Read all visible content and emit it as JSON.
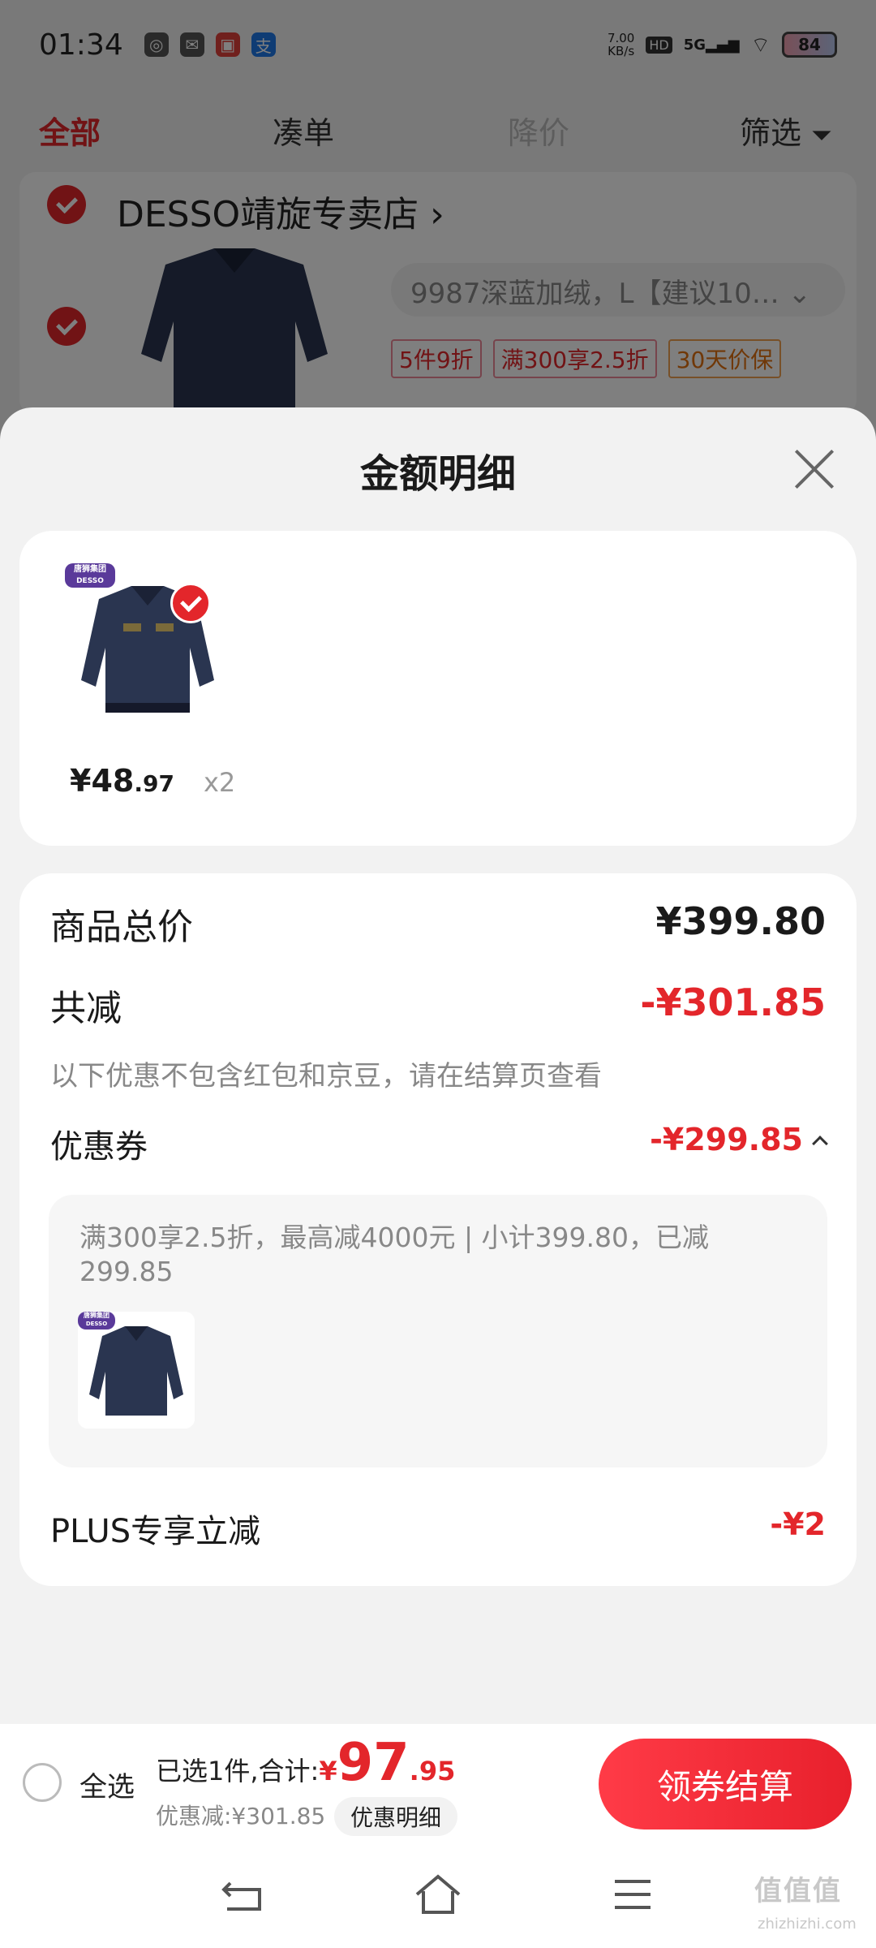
{
  "status_bar": {
    "time": "01:34",
    "net_speed_value": "7.00",
    "net_speed_unit": "KB/s",
    "hd": "HD",
    "signal": "5G",
    "battery": "84"
  },
  "tabs": [
    {
      "label": "全部",
      "state": "active"
    },
    {
      "label": "凑单",
      "state": "normal"
    },
    {
      "label": "降价",
      "state": "disabled"
    },
    {
      "label": "筛选",
      "state": "normal"
    }
  ],
  "cart_item": {
    "shop_name": "DESSO靖旋专卖店",
    "variant": "9987深蓝加绒，L【建议10…",
    "promo_tags": [
      "5件9折",
      "满300享2.5折",
      "30天价保"
    ]
  },
  "sheet": {
    "title": "金额明细",
    "product": {
      "brand_badge_line1": "唐狮集团",
      "brand_badge_line2": "DESSO",
      "price_int": "¥48",
      "price_dec": ".97",
      "qty": "x2"
    },
    "summary": {
      "total_label": "商品总价",
      "total_value": "¥399.80",
      "reduce_label": "共减",
      "reduce_value": "-¥301.85",
      "note": "以下优惠不包含红包和京豆，请在结算页查看",
      "coupon_label": "优惠券",
      "coupon_value": "-¥299.85",
      "coupon_desc": "满300享2.5折，最高减4000元 | 小计399.80，已减299.85",
      "plus_label": "PLUS专享立减",
      "plus_value": "-¥2"
    }
  },
  "checkout": {
    "select_all": "全选",
    "sum_label": "已选1件,合计:",
    "sum_yen": "¥",
    "sum_int": "97",
    "sum_dec": ".95",
    "discount": "优惠减:¥301.85",
    "detail_chip": "优惠明细",
    "pay_button": "领券结算"
  },
  "watermark": {
    "main": "值值值",
    "sub": "zhizhizhi.com"
  },
  "colors": {
    "accent_red": "#e3262b",
    "brand_purple": "#5a3a9a"
  }
}
